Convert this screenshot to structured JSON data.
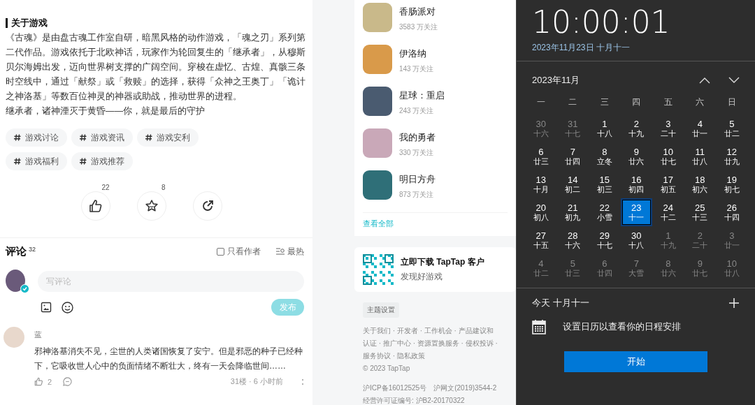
{
  "about": {
    "title": "关于游戏",
    "paragraphs": [
      "《古魂》是由盘古魂工作室自研，暗黑风格的动作游戏，「魂之刃」系列第二代作品。游戏依托于北欧神话，玩家作为轮回复生的「继承者」，从穆斯贝尔海姆出发，迈向世界树支撑的广阔空间。穿梭在虚忆、古煌、真骸三条时空线中，通过「献祭」或「救赎」的选择，获得「众神之王奥丁」「诡计之神洛基」等数百位神灵的神器或助战，推动世界的进程。",
      "继承者，诸神湮灭于黄昏——你，就是最后的守护"
    ]
  },
  "tags": [
    "游戏讨论",
    "游戏资讯",
    "游戏安利",
    "游戏福利",
    "游戏推荐"
  ],
  "actions": [
    {
      "kind": "like",
      "count": "22"
    },
    {
      "kind": "star",
      "count": "8"
    },
    {
      "kind": "share"
    }
  ],
  "comments_section": {
    "title": "评论",
    "count": "32",
    "only_author": {
      "label": "只看作者",
      "checked": false
    },
    "sort": "最热",
    "input": {
      "placeholder": "写评论"
    },
    "publish": {
      "label": "发布",
      "disabled": true
    }
  },
  "comments": [
    {
      "user": "蓝",
      "text": "邪神洛基消失不见，尘世的人类诸国恢复了安宁。但是邪恶的种子已经种下，它吸收世人心中的负面情绪不断壮大，终有一天会降临世间……",
      "likes": "2",
      "meta": "31楼 · 6 小时前"
    }
  ],
  "games": [
    {
      "name": "香肠派对",
      "followers": "3583 万关注"
    },
    {
      "name": "伊洛纳",
      "followers": "143 万关注"
    },
    {
      "name": "星球：重启",
      "followers": "243 万关注"
    },
    {
      "name": "我的勇者",
      "followers": "330 万关注"
    },
    {
      "name": "明日方舟",
      "followers": "873 万关注"
    }
  ],
  "see_all": "查看全部",
  "download": {
    "title": "立即下载 TapTap 客户",
    "subtitle": "发现好游戏"
  },
  "theme_button": "主题设置",
  "footer": {
    "links": [
      "关于我们 · 开发者 · 工作机会 · 产品建议和",
      "认证 · 推广中心 · 资源置换服务 · 侵权投诉 ·",
      "服务协议 · 隐私政策"
    ],
    "copyright": "© 2023 TapTap",
    "icp": [
      "沪ICP备16012525号",
      "沪网文(2019)3544-2"
    ],
    "license": "经营许可证编号: 沪B2-20170322"
  },
  "calendar": {
    "time": "10:00:01",
    "date": "2023年11月23日 十月十一",
    "month": "2023年11月",
    "weekdays": [
      "一",
      "二",
      "三",
      "四",
      "五",
      "六",
      "日"
    ],
    "days": [
      {
        "day": "30",
        "lunar": "十六",
        "in_month": false,
        "selected": false
      },
      {
        "day": "31",
        "lunar": "十七",
        "in_month": false,
        "selected": false
      },
      {
        "day": "1",
        "lunar": "十八",
        "in_month": true,
        "selected": false
      },
      {
        "day": "2",
        "lunar": "十九",
        "in_month": true,
        "selected": false
      },
      {
        "day": "3",
        "lunar": "二十",
        "in_month": true,
        "selected": false
      },
      {
        "day": "4",
        "lunar": "廿一",
        "in_month": true,
        "selected": false
      },
      {
        "day": "5",
        "lunar": "廿二",
        "in_month": true,
        "selected": false
      },
      {
        "day": "6",
        "lunar": "廿三",
        "in_month": true,
        "selected": false
      },
      {
        "day": "7",
        "lunar": "廿四",
        "in_month": true,
        "selected": false
      },
      {
        "day": "8",
        "lunar": "立冬",
        "in_month": true,
        "selected": false
      },
      {
        "day": "9",
        "lunar": "廿六",
        "in_month": true,
        "selected": false
      },
      {
        "day": "10",
        "lunar": "廿七",
        "in_month": true,
        "selected": false
      },
      {
        "day": "11",
        "lunar": "廿八",
        "in_month": true,
        "selected": false
      },
      {
        "day": "12",
        "lunar": "廿九",
        "in_month": true,
        "selected": false
      },
      {
        "day": "13",
        "lunar": "十月",
        "in_month": true,
        "selected": false
      },
      {
        "day": "14",
        "lunar": "初二",
        "in_month": true,
        "selected": false
      },
      {
        "day": "15",
        "lunar": "初三",
        "in_month": true,
        "selected": false
      },
      {
        "day": "16",
        "lunar": "初四",
        "in_month": true,
        "selected": false
      },
      {
        "day": "17",
        "lunar": "初五",
        "in_month": true,
        "selected": false
      },
      {
        "day": "18",
        "lunar": "初六",
        "in_month": true,
        "selected": false
      },
      {
        "day": "19",
        "lunar": "初七",
        "in_month": true,
        "selected": false
      },
      {
        "day": "20",
        "lunar": "初八",
        "in_month": true,
        "selected": false
      },
      {
        "day": "21",
        "lunar": "初九",
        "in_month": true,
        "selected": false
      },
      {
        "day": "22",
        "lunar": "小雪",
        "in_month": true,
        "selected": false
      },
      {
        "day": "23",
        "lunar": "十一",
        "in_month": true,
        "selected": true
      },
      {
        "day": "24",
        "lunar": "十二",
        "in_month": true,
        "selected": false
      },
      {
        "day": "25",
        "lunar": "十三",
        "in_month": true,
        "selected": false
      },
      {
        "day": "26",
        "lunar": "十四",
        "in_month": true,
        "selected": false
      },
      {
        "day": "27",
        "lunar": "十五",
        "in_month": true,
        "selected": false
      },
      {
        "day": "28",
        "lunar": "十六",
        "in_month": true,
        "selected": false
      },
      {
        "day": "29",
        "lunar": "十七",
        "in_month": true,
        "selected": false
      },
      {
        "day": "30",
        "lunar": "十八",
        "in_month": true,
        "selected": false
      },
      {
        "day": "1",
        "lunar": "十九",
        "in_month": false,
        "selected": false
      },
      {
        "day": "2",
        "lunar": "二十",
        "in_month": false,
        "selected": false
      },
      {
        "day": "3",
        "lunar": "廿一",
        "in_month": false,
        "selected": false
      },
      {
        "day": "4",
        "lunar": "廿二",
        "in_month": false,
        "selected": false
      },
      {
        "day": "5",
        "lunar": "廿三",
        "in_month": false,
        "selected": false
      },
      {
        "day": "6",
        "lunar": "廿四",
        "in_month": false,
        "selected": false
      },
      {
        "day": "7",
        "lunar": "大雪",
        "in_month": false,
        "selected": false
      },
      {
        "day": "8",
        "lunar": "廿六",
        "in_month": false,
        "selected": false
      },
      {
        "day": "9",
        "lunar": "廿七",
        "in_month": false,
        "selected": false
      },
      {
        "day": "10",
        "lunar": "廿八",
        "in_month": false,
        "selected": false
      }
    ],
    "today": "今天 十月十一",
    "agenda": "设置日历以查看你的日程安排",
    "start": "开始"
  }
}
